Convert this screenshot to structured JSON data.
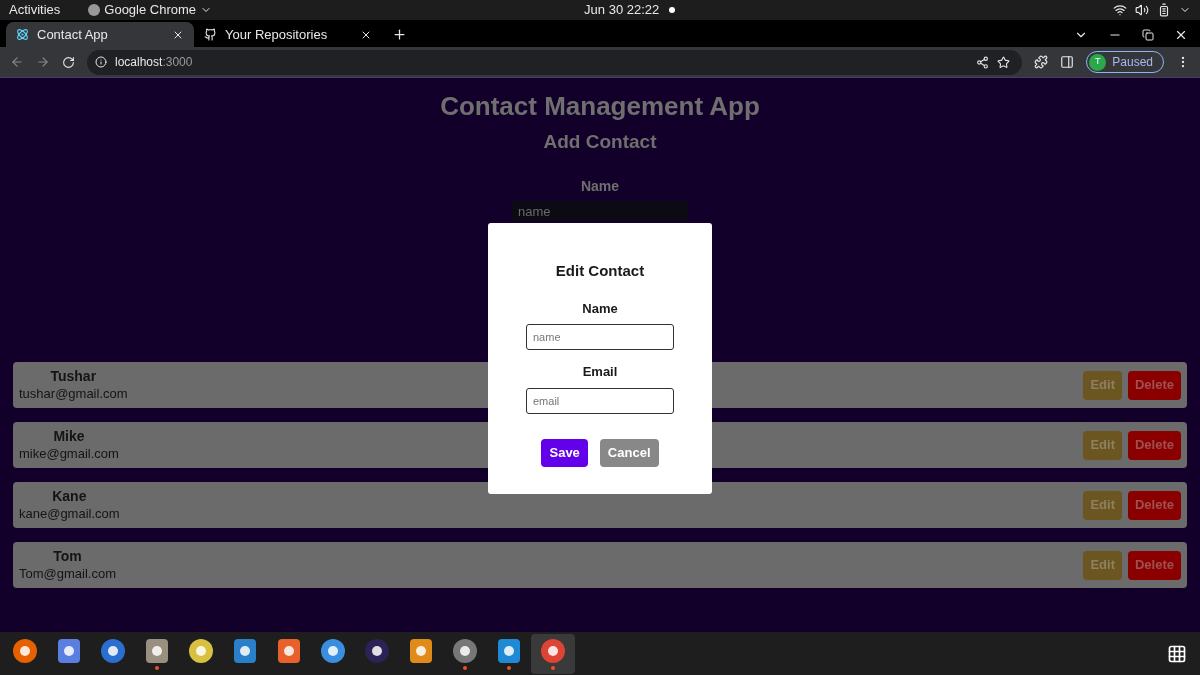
{
  "top_bar": {
    "activities": "Activities",
    "app_menu": "Google Chrome",
    "clock": "Jun 30  22:22"
  },
  "tabs": [
    {
      "title": "Contact App",
      "selected": true
    },
    {
      "title": "Your Repositories",
      "selected": false
    }
  ],
  "address_bar": {
    "host": "localhost",
    "port": ":3000"
  },
  "profile": {
    "initial": "T",
    "status": "Paused"
  },
  "page": {
    "title": "Contact Management App",
    "form_title": "Add Contact",
    "name_label": "Name",
    "name_placeholder": "name"
  },
  "contacts": [
    {
      "name": "Tushar",
      "email": "tushar@gmail.com",
      "edit": "Edit",
      "delete": "Delete"
    },
    {
      "name": "Mike",
      "email": "mike@gmail.com",
      "edit": "Edit",
      "delete": "Delete"
    },
    {
      "name": "Kane",
      "email": "kane@gmail.com",
      "edit": "Edit",
      "delete": "Delete"
    },
    {
      "name": "Tom",
      "email": "Tom@gmail.com",
      "edit": "Edit",
      "delete": "Delete"
    }
  ],
  "dialog": {
    "title": "Edit Contact",
    "name_label": "Name",
    "name_placeholder": "name",
    "email_label": "Email",
    "email_placeholder": "email",
    "save": "Save",
    "cancel": "Cancel"
  },
  "dock": [
    {
      "kind": "firefox",
      "running": false
    },
    {
      "kind": "tasks",
      "running": false
    },
    {
      "kind": "mail",
      "running": false
    },
    {
      "kind": "files",
      "running": true
    },
    {
      "kind": "music",
      "running": false
    },
    {
      "kind": "writer",
      "running": false
    },
    {
      "kind": "store",
      "running": false
    },
    {
      "kind": "help",
      "running": false
    },
    {
      "kind": "eclipse",
      "running": false
    },
    {
      "kind": "sublime",
      "running": false
    },
    {
      "kind": "settings",
      "running": true
    },
    {
      "kind": "vscode",
      "running": true
    },
    {
      "kind": "chrome",
      "running": true
    }
  ]
}
